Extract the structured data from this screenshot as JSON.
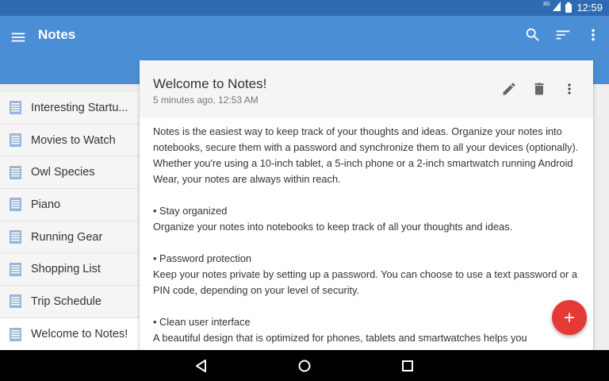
{
  "status_bar": {
    "network": "3G",
    "time": "12:59"
  },
  "app_bar": {
    "title": "Notes"
  },
  "notes_list": [
    {
      "label": "Interesting Startu..."
    },
    {
      "label": "Movies to Watch"
    },
    {
      "label": "Owl Species"
    },
    {
      "label": "Piano"
    },
    {
      "label": "Running Gear"
    },
    {
      "label": "Shopping List"
    },
    {
      "label": "Trip Schedule"
    },
    {
      "label": "Welcome to Notes!"
    }
  ],
  "note": {
    "title": "Welcome to Notes!",
    "subtitle": "5 minutes ago, 12:53 AM",
    "paragraphs": [
      "Notes is the easiest way to keep track of your thoughts and ideas. Organize your notes into notebooks, secure them with a password and synchronize them to all your devices (optionally). Whether you're using a 10-inch tablet, a 5-inch phone or a 2-inch smartwatch running Android Wear, your notes are always within reach.",
      "• Stay organized",
      "Organize your notes into notebooks to keep track of all your thoughts and ideas.",
      "• Password protection",
      "Keep your notes private by setting up a password. You can choose to use a text password or a PIN code, depending on your level of security.",
      "• Clean user interface",
      "A beautiful design that is optimized for phones, tablets and smartwatches helps you"
    ]
  },
  "icons": {
    "menu": "menu-icon",
    "search": "search-icon",
    "sort": "sort-icon",
    "more": "more-vert-icon",
    "edit": "pencil-icon",
    "delete": "trash-icon",
    "add": "plus-icon",
    "note": "note-icon",
    "back": "back-icon",
    "home": "home-icon",
    "recents": "recents-icon"
  },
  "colors": {
    "status_bar": "#2f6bb3",
    "app_bar": "#4a8fd6",
    "fab": "#e53935",
    "note_icon": "#9bb5d6"
  }
}
